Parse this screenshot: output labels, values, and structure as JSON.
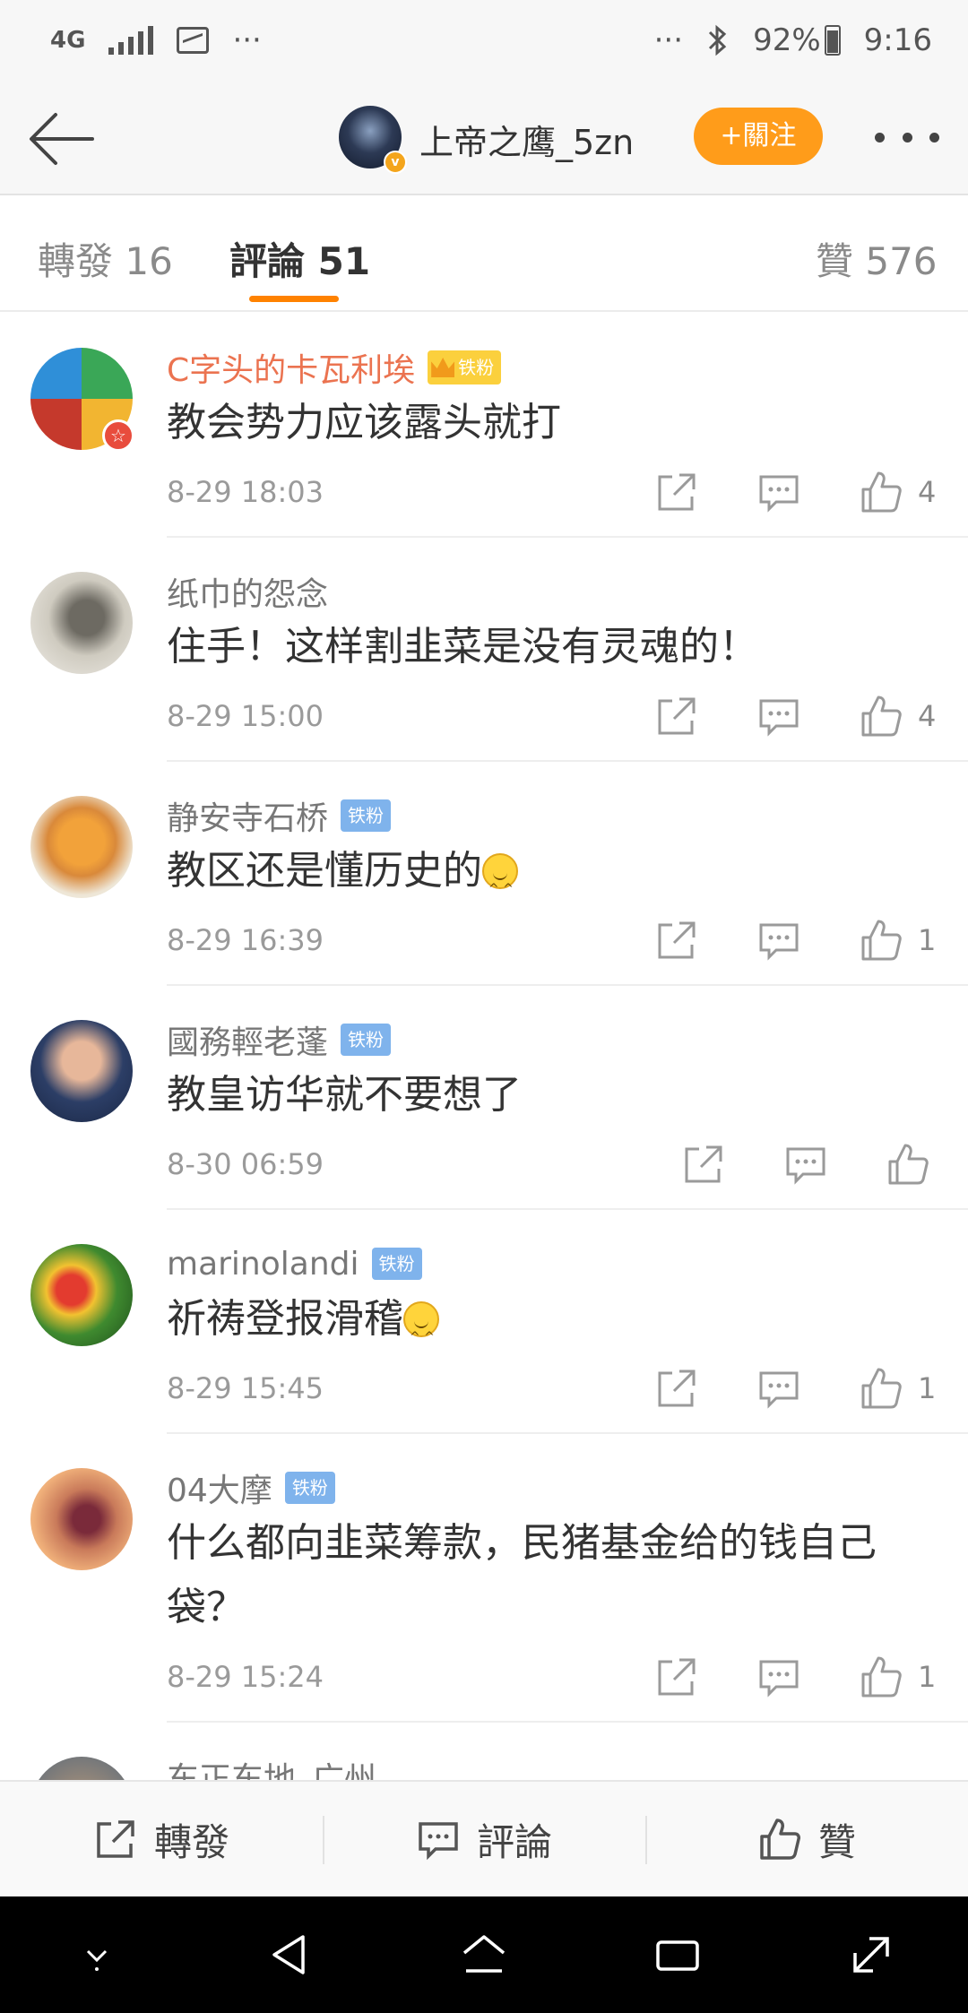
{
  "status_bar": {
    "network": "4G",
    "dots_left": "···",
    "dots_right": "···",
    "battery": "92%",
    "time": "9:16"
  },
  "header": {
    "username": "上帝之鹰_5zn",
    "follow_label": "+關注",
    "verified_mark": "v"
  },
  "tabs": {
    "repost": "轉發 16",
    "comments": "評論 51",
    "likes": "贊 576"
  },
  "comments": [
    {
      "name": "C字头的卡瓦利埃",
      "badge": "铁粉",
      "text": "教会势力应该露头就打",
      "time": "8-29 18:03",
      "likes": "4"
    },
    {
      "name": "纸巾的怨念",
      "badge": "",
      "text": "住手！这样割韭菜是没有灵魂的！",
      "time": "8-29 15:00",
      "likes": "4"
    },
    {
      "name": "静安寺石桥",
      "badge": "铁粉",
      "text": "教区还是懂历史的",
      "time": "8-29 16:39",
      "likes": "1"
    },
    {
      "name": "國務輕老蓬",
      "badge": "铁粉",
      "text": "教皇访华就不要想了",
      "time": "8-30 06:59",
      "likes": ""
    },
    {
      "name": "marinolandi",
      "badge": "铁粉",
      "text": "祈祷登报滑稽",
      "time": "8-29 15:45",
      "likes": "1"
    },
    {
      "name": "04大摩",
      "badge": "铁粉",
      "text": "什么都向韭菜筹款，民猪基金给的钱自己袋？",
      "time": "8-29 15:24",
      "likes": "1"
    },
    {
      "name": "东正东地_广州",
      "badge": "",
      "text": "",
      "time": "",
      "likes": ""
    }
  ],
  "action_bar": {
    "repost": "轉發",
    "comment": "評論",
    "like": "贊"
  },
  "colors": {
    "accent": "#ff8200",
    "follow_button": "#ff9c1a",
    "vip_name": "#eb7350",
    "fan_badge": "#7fb3ec"
  }
}
